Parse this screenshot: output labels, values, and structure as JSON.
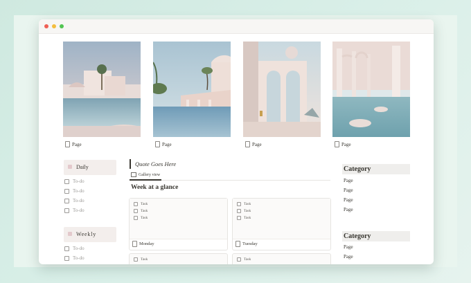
{
  "gallery": [
    {
      "label": "Page"
    },
    {
      "label": "Page"
    },
    {
      "label": "Page"
    },
    {
      "label": "Page"
    }
  ],
  "left": {
    "daily_title": "Daily",
    "daily_items": [
      "To-do",
      "To-do",
      "To-do",
      "To-do"
    ],
    "weekly_title": "Weekly",
    "weekly_items": [
      "To-do",
      "To-do"
    ]
  },
  "main": {
    "quote": "Quote  Goes Here",
    "view_tab": "Gallery view",
    "week_title": "Week at a glance",
    "days": [
      {
        "name": "Monday",
        "tasks": [
          "Task",
          "Task",
          "Task"
        ]
      },
      {
        "name": "Tuesday",
        "tasks": [
          "Task",
          "Task",
          "Task"
        ]
      }
    ],
    "next_row_tasks": [
      "Task",
      "Task"
    ]
  },
  "right": {
    "categories": [
      {
        "title": "Category",
        "items": [
          "Page",
          "Page",
          "Page",
          "Page"
        ]
      },
      {
        "title": "Category",
        "items": [
          "Page",
          "Page"
        ]
      }
    ]
  },
  "colors": {
    "background": "#d9efe8",
    "accent_box": "#f3eeec",
    "pool_blue": "#8fb4c4",
    "architecture_pink": "#ecd9d0"
  }
}
